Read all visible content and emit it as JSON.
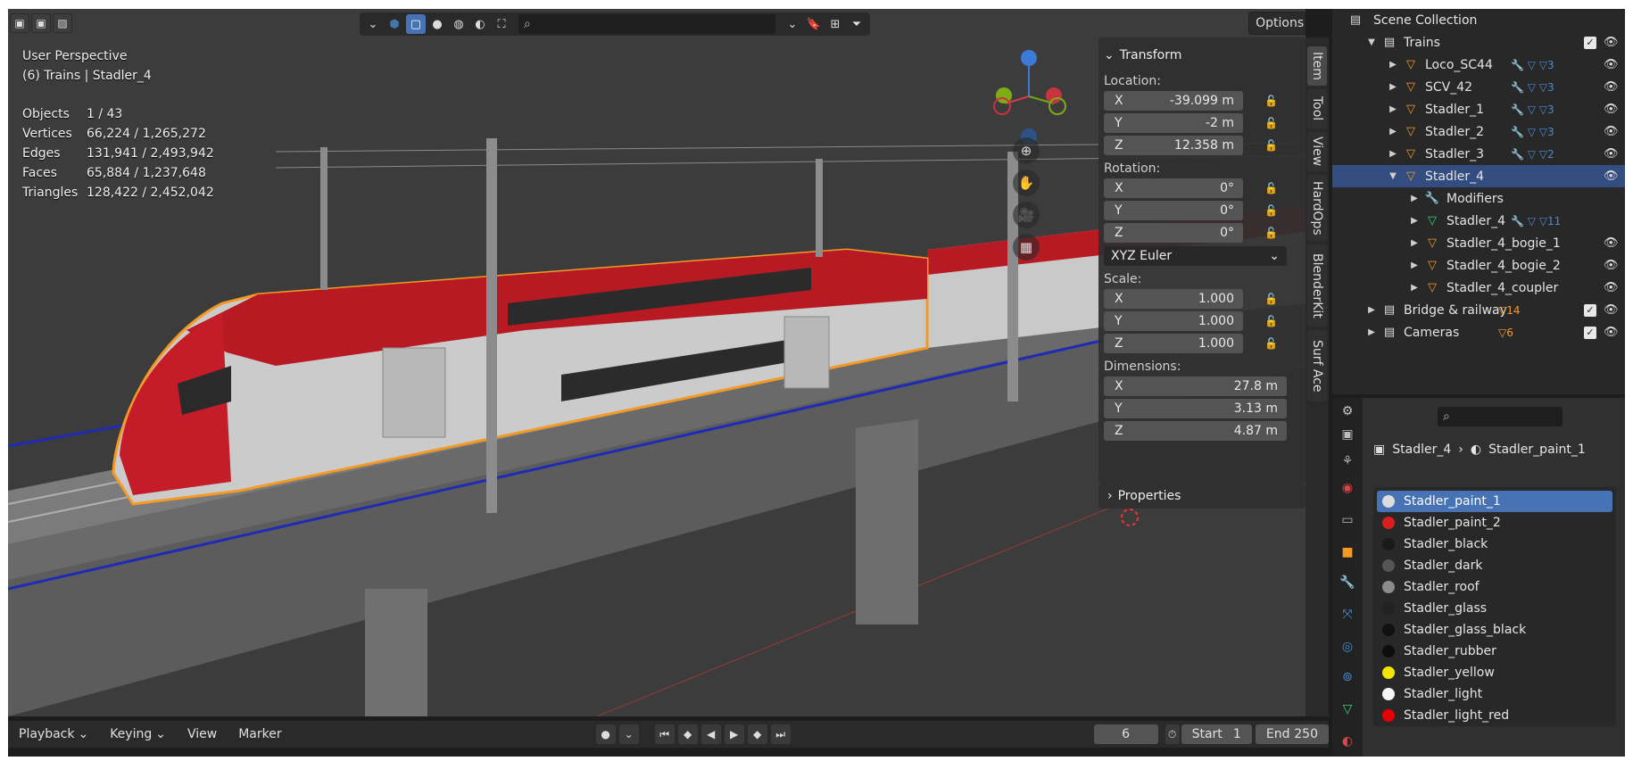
{
  "viewport": {
    "header_icons": [
      "selection-mode-icons"
    ],
    "search_placeholder": "",
    "options_label": "Options",
    "perspective": "User Perspective",
    "context": "(6) Trains | Stadler_4",
    "stats": [
      {
        "label": "Objects",
        "value": "1 / 43"
      },
      {
        "label": "Vertices",
        "value": "66,224 / 1,265,272"
      },
      {
        "label": "Edges",
        "value": "131,941 / 2,493,942"
      },
      {
        "label": "Faces",
        "value": "65,884 / 1,237,648"
      },
      {
        "label": "Triangles",
        "value": "128,422 / 2,452,042"
      }
    ],
    "gizmo_axes": {
      "x": "X",
      "y": "Y",
      "z": "Z"
    }
  },
  "side_tabs": [
    "Item",
    "Tool",
    "View",
    "HardOps",
    "BlenderKit",
    "Surf Ace"
  ],
  "transform": {
    "title": "Transform",
    "location_label": "Location:",
    "location": [
      {
        "axis": "X",
        "value": "-39.099 m"
      },
      {
        "axis": "Y",
        "value": "-2 m"
      },
      {
        "axis": "Z",
        "value": "12.358 m"
      }
    ],
    "rotation_label": "Rotation:",
    "rotation": [
      {
        "axis": "X",
        "value": "0°"
      },
      {
        "axis": "Y",
        "value": "0°"
      },
      {
        "axis": "Z",
        "value": "0°"
      }
    ],
    "rotation_mode": "XYZ Euler",
    "scale_label": "Scale:",
    "scale": [
      {
        "axis": "X",
        "value": "1.000"
      },
      {
        "axis": "Y",
        "value": "1.000"
      },
      {
        "axis": "Z",
        "value": "1.000"
      }
    ],
    "dimensions_label": "Dimensions:",
    "dimensions": [
      {
        "axis": "X",
        "value": "27.8 m"
      },
      {
        "axis": "Y",
        "value": "3.13 m"
      },
      {
        "axis": "Z",
        "value": "4.87 m"
      }
    ],
    "properties_label": "Properties"
  },
  "timeline": {
    "menus": [
      "Playback",
      "Keying",
      "View",
      "Marker"
    ],
    "current_frame": "6",
    "start_label": "Start",
    "start": "1",
    "end_label": "End",
    "end": "250"
  },
  "outliner": {
    "root": "Scene Collection",
    "rows": [
      {
        "label": "Trains",
        "type": "collection",
        "depth": 1,
        "expanded": true,
        "check": true
      },
      {
        "label": "Loco_SC44",
        "type": "object",
        "depth": 2,
        "count": "3"
      },
      {
        "label": "SCV_42",
        "type": "object",
        "depth": 2,
        "count": "3"
      },
      {
        "label": "Stadler_1",
        "type": "object",
        "depth": 2,
        "count": "3"
      },
      {
        "label": "Stadler_2",
        "type": "object",
        "depth": 2,
        "count": "3"
      },
      {
        "label": "Stadler_3",
        "type": "object",
        "depth": 2,
        "count": "2"
      },
      {
        "label": "Stadler_4",
        "type": "object",
        "depth": 2,
        "expanded": true,
        "selected": true
      },
      {
        "label": "Modifiers",
        "type": "modifiers",
        "depth": 3
      },
      {
        "label": "Stadler_4",
        "type": "mesh",
        "depth": 3,
        "count": "11"
      },
      {
        "label": "Stadler_4_bogie_1",
        "type": "object",
        "depth": 3
      },
      {
        "label": "Stadler_4_bogie_2",
        "type": "object",
        "depth": 3
      },
      {
        "label": "Stadler_4_coupler",
        "type": "object",
        "depth": 3
      },
      {
        "label": "Bridge & railway",
        "type": "collection",
        "depth": 1,
        "count": "14",
        "check": true
      },
      {
        "label": "Cameras",
        "type": "collection",
        "depth": 1,
        "count": "6",
        "check": true
      }
    ]
  },
  "properties": {
    "search_placeholder": "",
    "breadcrumb_object": "Stadler_4",
    "breadcrumb_material": "Stadler_paint_1",
    "materials": [
      {
        "name": "Stadler_paint_1",
        "color": "#dcdcdc",
        "selected": true
      },
      {
        "name": "Stadler_paint_2",
        "color": "#d81e1e"
      },
      {
        "name": "Stadler_black",
        "color": "#1a1a1a"
      },
      {
        "name": "Stadler_dark",
        "color": "#555555"
      },
      {
        "name": "Stadler_roof",
        "color": "#8a8a8a"
      },
      {
        "name": "Stadler_glass",
        "color": "#222222"
      },
      {
        "name": "Stadler_glass_black",
        "color": "#111111"
      },
      {
        "name": "Stadler_rubber",
        "color": "#0d0d0d"
      },
      {
        "name": "Stadler_yellow",
        "color": "#f2e600"
      },
      {
        "name": "Stadler_light",
        "color": "#f5f5f5"
      },
      {
        "name": "Stadler_light_red",
        "color": "#e80000"
      }
    ]
  }
}
